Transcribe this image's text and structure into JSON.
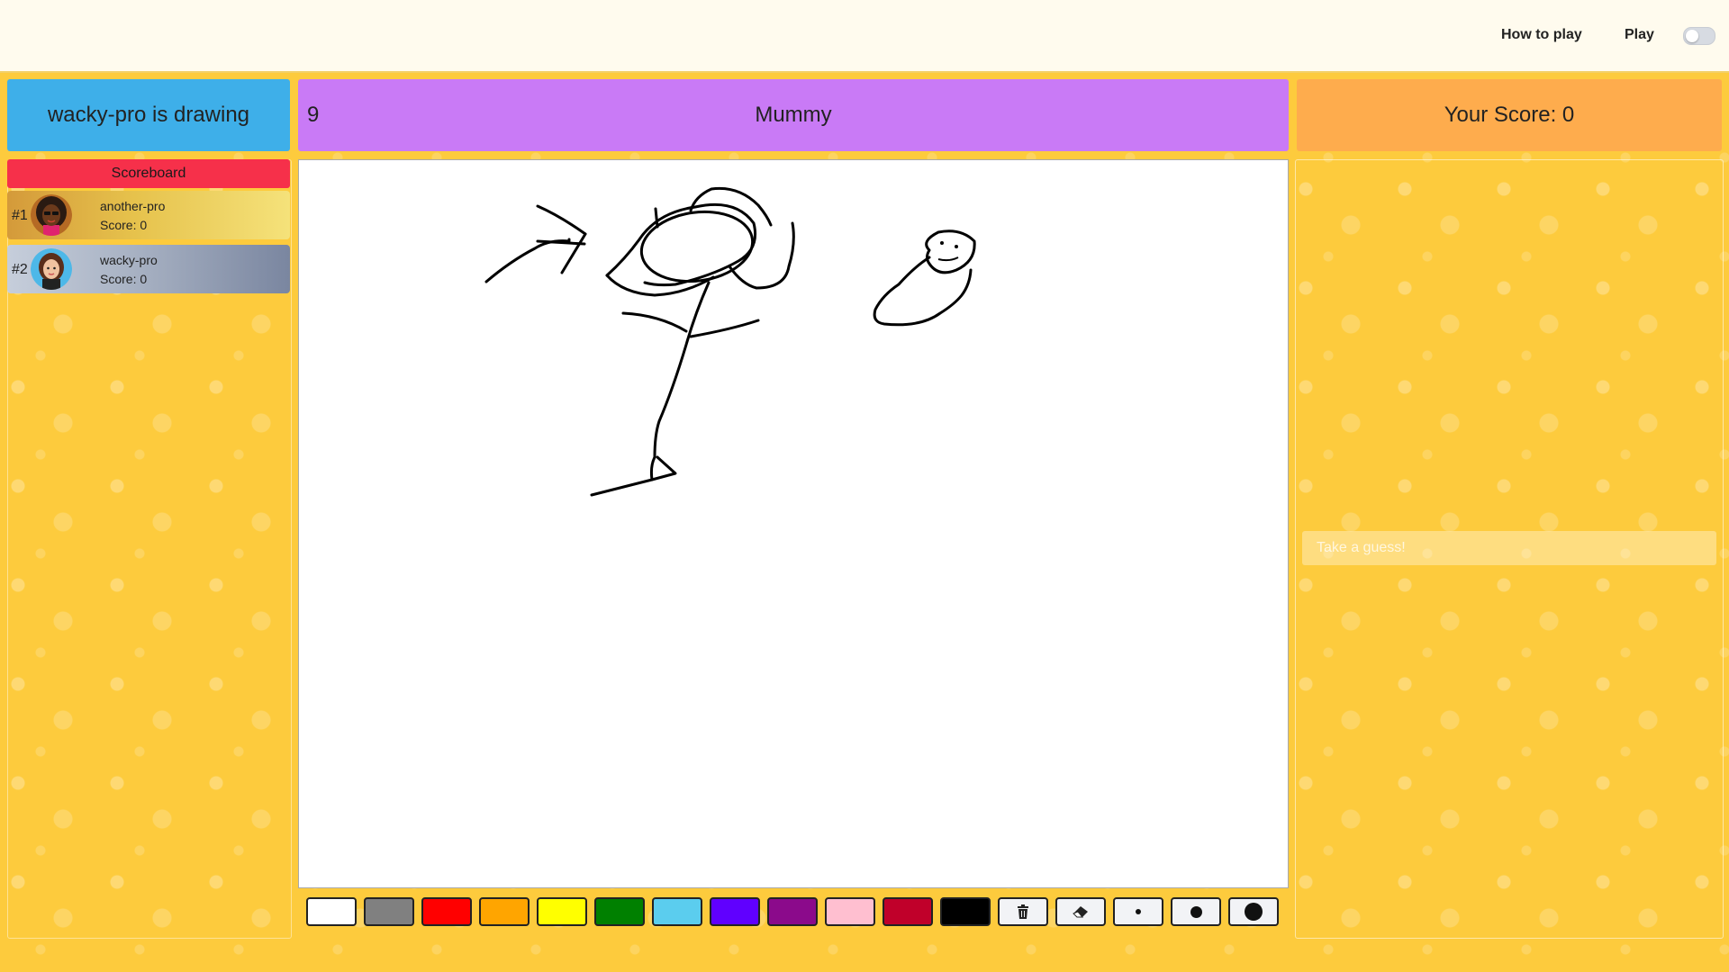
{
  "nav": {
    "how_to_play": "How to play",
    "play": "Play",
    "toggle_on": false
  },
  "status": {
    "text": "wacky-pro is drawing"
  },
  "word": {
    "timer": "9",
    "text": "Mummy"
  },
  "score": {
    "text": "Your Score: 0"
  },
  "scoreboard": {
    "title": "Scoreboard",
    "players": [
      {
        "rank": "#1",
        "name": "another-pro",
        "score": "Score: 0"
      },
      {
        "rank": "#2",
        "name": "wacky-pro",
        "score": "Score: 0"
      }
    ]
  },
  "chat": {
    "placeholder": "Take a guess!"
  },
  "palette": {
    "colors": [
      "#ffffff",
      "#808080",
      "#ff0000",
      "#ffa500",
      "#ffff00",
      "#008000",
      "#5bcdee",
      "#6000ff",
      "#8b0a8b",
      "#ffbfd0",
      "#c0002a",
      "#000000"
    ]
  },
  "tools": [
    "trash-icon",
    "eraser-icon",
    "brush-size-small",
    "brush-size-medium",
    "brush-size-large"
  ],
  "colors": {
    "topbar": "#fffbee",
    "background": "#fdcb3d",
    "status_bg": "#3eafe9",
    "word_bg": "#c97af6",
    "score_bg": "#feac4d",
    "scoreboard_title_bg": "#f6304a"
  }
}
